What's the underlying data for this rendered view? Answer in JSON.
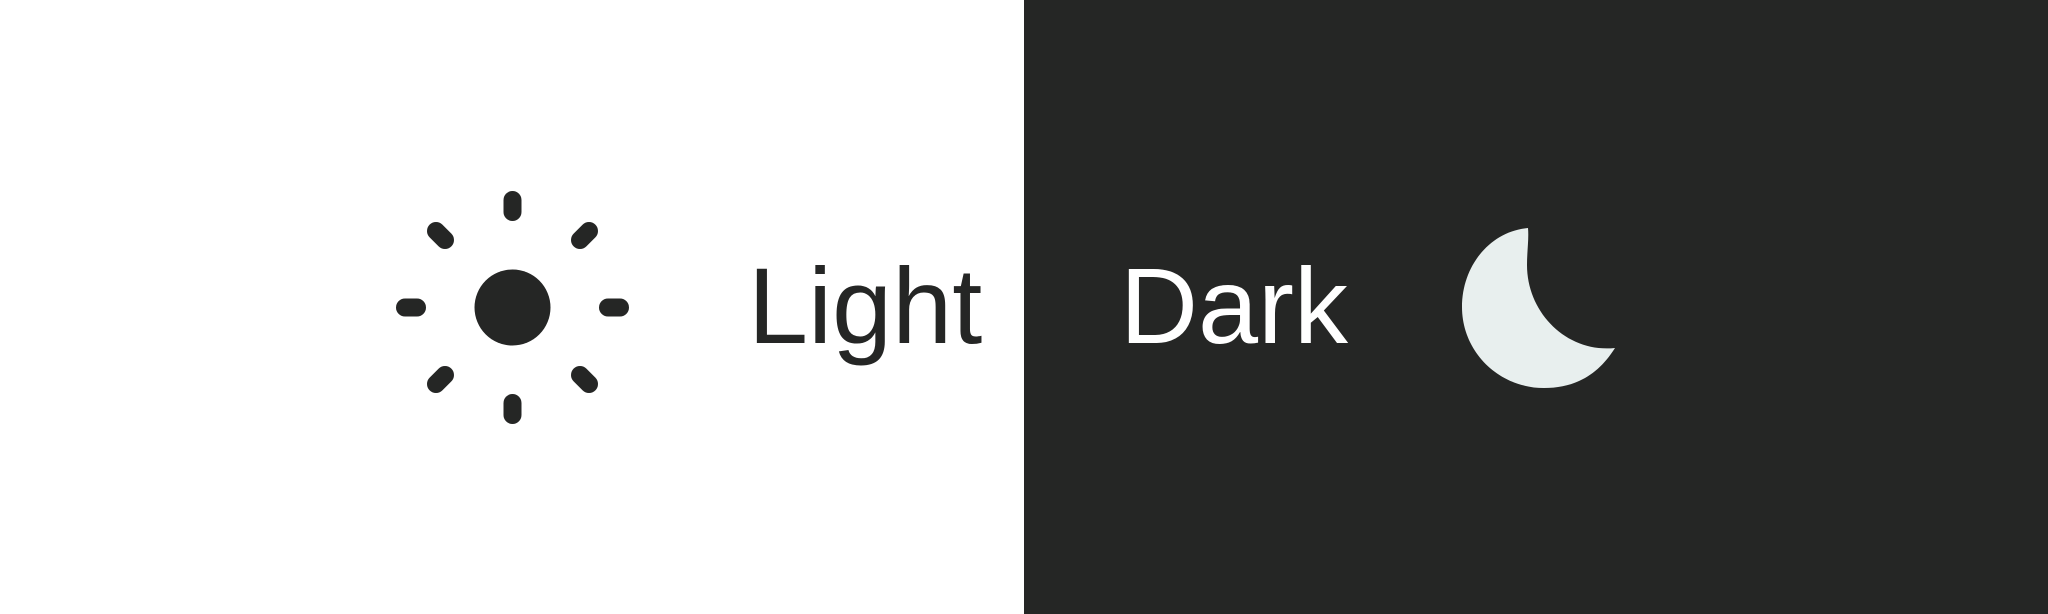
{
  "theme_selector": {
    "light": {
      "label": "Light",
      "icon": "sun-icon",
      "background": "#ffffff",
      "foreground": "#252625"
    },
    "dark": {
      "label": "Dark",
      "icon": "moon-icon",
      "background": "#252625",
      "foreground": "#ffffff",
      "icon_color": "#e8efee"
    }
  }
}
